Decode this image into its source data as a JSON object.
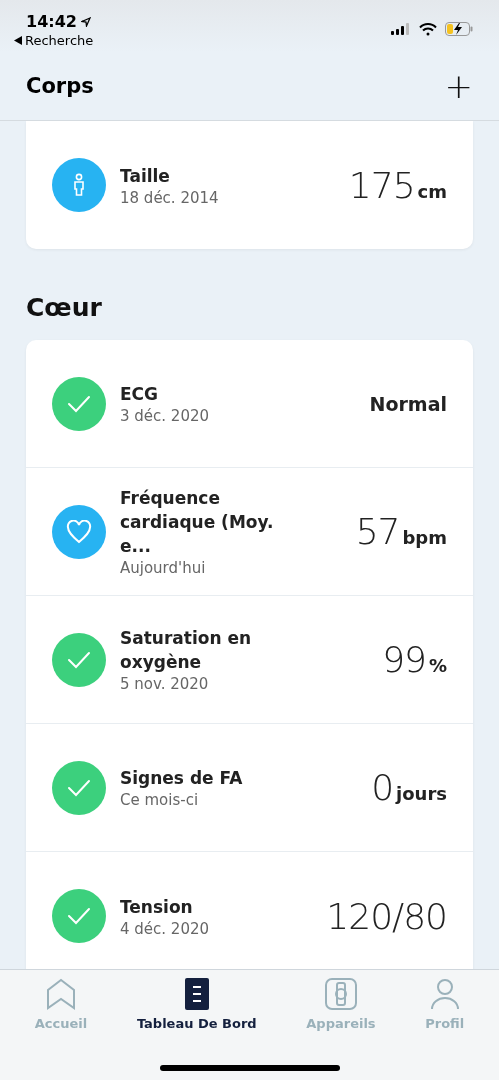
{
  "status_bar": {
    "time": "14:42",
    "back_label": "Recherche"
  },
  "header": {
    "title": "Corps",
    "add_symbol": "+"
  },
  "sections": [
    {
      "items": [
        {
          "kind": "person",
          "name": "Taille",
          "date": "18 déc. 2014",
          "value": {
            "kind": "number",
            "text": "175"
          },
          "unit": "cm"
        }
      ]
    },
    {
      "title": "Cœur",
      "items": [
        {
          "kind": "check",
          "name": "ECG",
          "date": "3 déc. 2020",
          "value": {
            "kind": "word",
            "text": "Normal"
          }
        },
        {
          "kind": "heart",
          "name": "Fréquence cardiaque (Moy. e...",
          "date": "Aujourd'hui",
          "value": {
            "kind": "number",
            "text": "57"
          },
          "unit": "bpm"
        },
        {
          "kind": "check",
          "name": "Saturation en oxygène",
          "date": "5 nov. 2020",
          "value": {
            "kind": "number",
            "text": "99"
          },
          "unit": "%"
        },
        {
          "kind": "check",
          "name": "Signes de FA",
          "date": "Ce mois-ci",
          "value": {
            "kind": "number",
            "text": "0"
          },
          "unit": "jours"
        },
        {
          "kind": "check",
          "name": "Tension",
          "date": "4 déc. 2020",
          "value": {
            "kind": "number",
            "text": "120/80"
          }
        }
      ]
    }
  ],
  "tabs": [
    {
      "label": "Accueil",
      "kind": "home",
      "selected": false
    },
    {
      "label": "Tableau De Bord",
      "kind": "dashboard",
      "selected": true
    },
    {
      "label": "Appareils",
      "kind": "watch",
      "selected": false
    },
    {
      "label": "Profil",
      "kind": "person",
      "selected": false
    }
  ]
}
